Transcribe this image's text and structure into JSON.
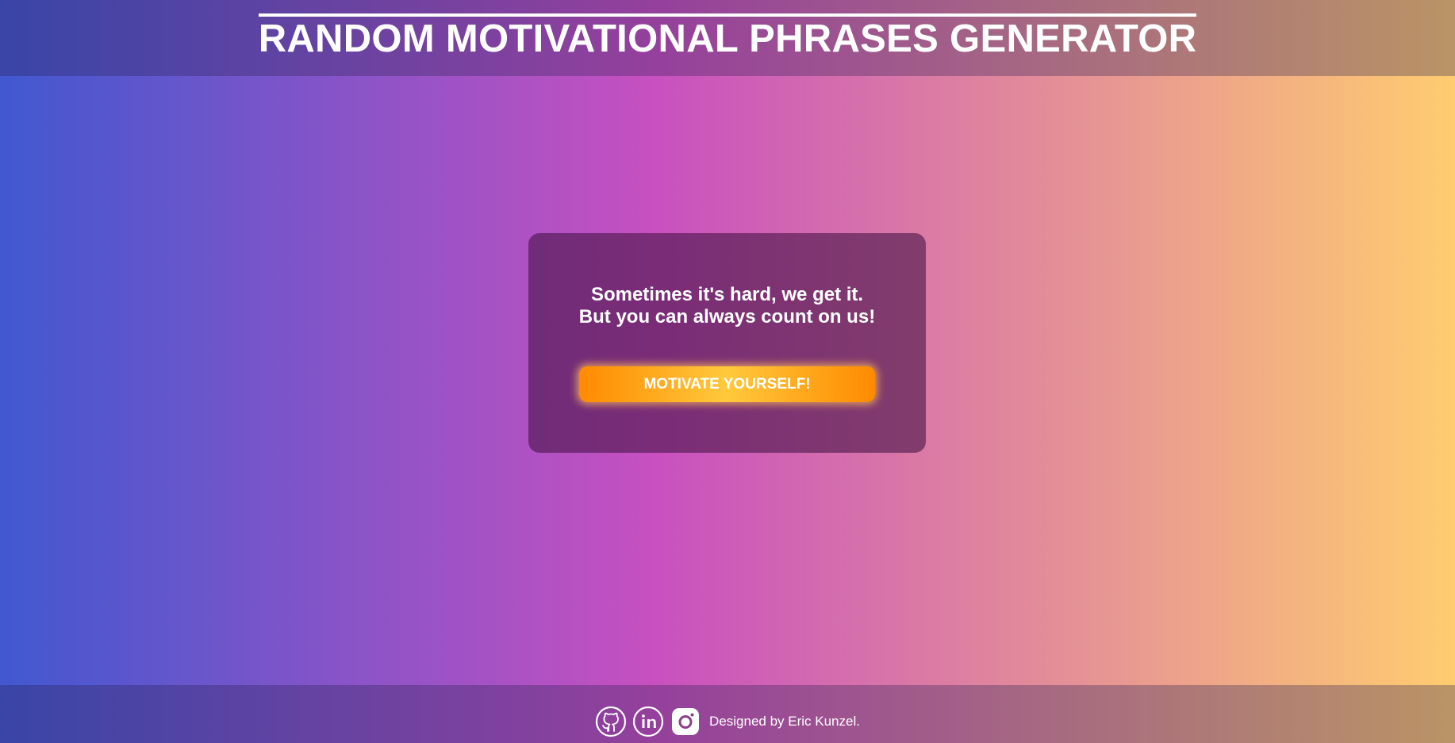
{
  "header": {
    "title": "RANDOM MOTIVATIONAL PHRASES GENERATOR"
  },
  "card": {
    "phrase_line1": "Sometimes it's hard, we get it.",
    "phrase_line2": "But you can always count on us!",
    "button_label": "MOTIVATE YOURSELF!"
  },
  "footer": {
    "social_links": [
      {
        "icon": "github-icon"
      },
      {
        "icon": "linkedin-icon"
      },
      {
        "icon": "instagram-icon"
      }
    ],
    "credit": "Designed by Eric Kunzel."
  },
  "colors": {
    "gradient_start": "#4158d0",
    "gradient_mid": "#c850c0",
    "gradient_end": "#ffcc70",
    "button_orange": "#ff8a00",
    "button_yellow": "#ffc93c",
    "text": "#ffffff"
  }
}
